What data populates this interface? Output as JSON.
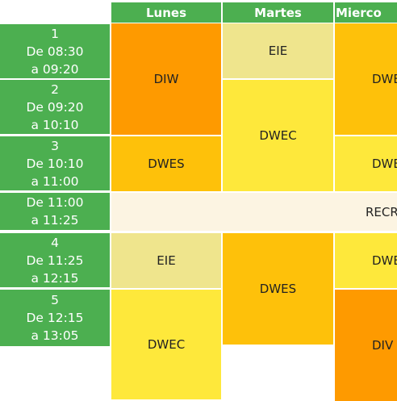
{
  "days": [
    "Lunes",
    "Martes",
    "Mierco"
  ],
  "periods": [
    {
      "num": "1",
      "from": "De 08:30",
      "to": "a 09:20"
    },
    {
      "num": "2",
      "from": "De 09:20",
      "to": "a 10:10"
    },
    {
      "num": "3",
      "from": "De 10:10",
      "to": "a 11:00"
    },
    {
      "num": "",
      "from": "De 11:00",
      "to": "a 11:25"
    },
    {
      "num": "4",
      "from": "De 11:25",
      "to": "a 12:15"
    },
    {
      "num": "5",
      "from": "De 12:15",
      "to": "a 13:05"
    }
  ],
  "subjects": {
    "lunes_1_2": "DIW",
    "lunes_3": "DWES",
    "lunes_4": "EIE",
    "lunes_5": "DWEC",
    "martes_1": "EIE",
    "martes_2_3": "DWEC",
    "martes_4_5": "DWES",
    "miercoles_1_2": "DWE",
    "miercoles_3": "DWE",
    "miercoles_4": "DWE",
    "miercoles_5": "DIV"
  },
  "recreo": "RECR",
  "colors": {
    "header": "#4caf50",
    "orange": "#fe9a00",
    "amber": "#fec10a",
    "yellow": "#fee83b",
    "khaki": "#efe58d",
    "recreo": "#fcf4e2"
  }
}
